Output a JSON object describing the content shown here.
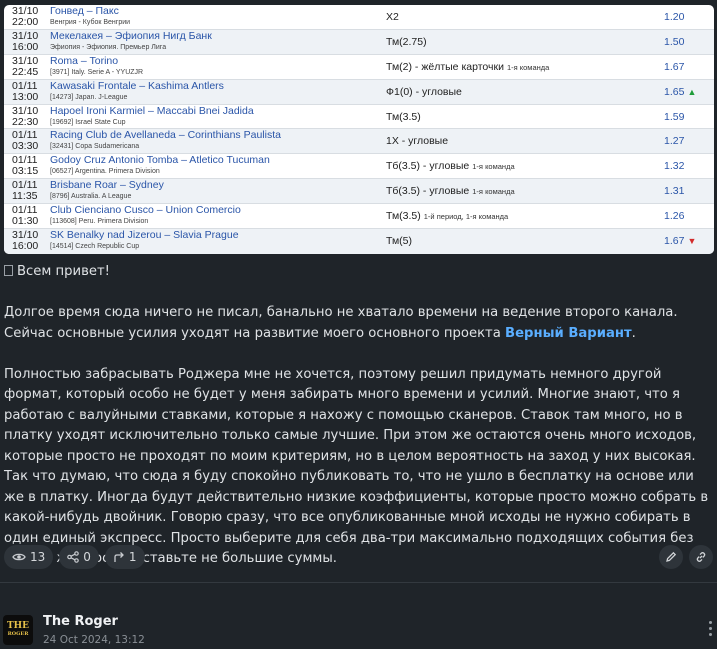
{
  "bets": [
    {
      "date": "31/10",
      "time": "22:00",
      "teams": "Гонвед – Пакс",
      "league": "Венгрия - Кубок Венгрии",
      "market": "X2",
      "market_sub": "",
      "odds": "1.20",
      "trend": ""
    },
    {
      "date": "31/10",
      "time": "16:00",
      "teams": "Мекелакея – Эфиопия Нигд Банк",
      "league": "Эфиопия - Эфиопия. Премьер Лига",
      "market": "Тм(2.75)",
      "market_sub": "",
      "odds": "1.50",
      "trend": ""
    },
    {
      "date": "31/10",
      "time": "22:45",
      "teams": "Roma – Torino",
      "league": "[3971] Italy. Serie A - YYUZJR",
      "market": "Тм(2) - жёлтые карточки",
      "market_sub": "1-я команда",
      "odds": "1.67",
      "trend": ""
    },
    {
      "date": "01/11",
      "time": "13:00",
      "teams": "Kawasaki Frontale – Kashima Antlers",
      "league": "[14273] Japan. J-League",
      "market": "Ф1(0) - угловые",
      "market_sub": "",
      "odds": "1.65",
      "trend": "up"
    },
    {
      "date": "31/10",
      "time": "22:30",
      "teams": "Hapoel Ironi Karmiel – Maccabi Bnei Jadida",
      "league": "[19692] Israel State Cup",
      "market": "Тм(3.5)",
      "market_sub": "",
      "odds": "1.59",
      "trend": ""
    },
    {
      "date": "01/11",
      "time": "03:30",
      "teams": "Racing Club de Avellaneda – Corinthians Paulista",
      "league": "[32431] Copa Sudamericana",
      "market": "1X - угловые",
      "market_sub": "",
      "odds": "1.27",
      "trend": ""
    },
    {
      "date": "01/11",
      "time": "03:15",
      "teams": "Godoy Cruz Antonio Tomba – Atletico Tucuman",
      "league": "[06527] Argentina. Primera Division",
      "market": "Тб(3.5) - угловые",
      "market_sub": "1-я команда",
      "odds": "1.32",
      "trend": ""
    },
    {
      "date": "01/11",
      "time": "11:35",
      "teams": "Brisbane Roar – Sydney",
      "league": "[8796] Australia. A League",
      "market": "Тб(3.5) - угловые",
      "market_sub": "1-я команда",
      "odds": "1.31",
      "trend": ""
    },
    {
      "date": "01/11",
      "time": "01:30",
      "teams": "Club Cienciano Cusco – Union Comercio",
      "league": "[113608] Peru. Primera Division",
      "market": "Тм(3.5)",
      "market_sub": "1-й период, 1-я команда",
      "odds": "1.26",
      "trend": ""
    },
    {
      "date": "31/10",
      "time": "16:00",
      "teams": "SK Benalky nad Jizerou – Slavia Prague",
      "league": "[14514] Czech Republic Cup",
      "market": "Тм(5)",
      "market_sub": "",
      "odds": "1.67",
      "trend": "down"
    }
  ],
  "post": {
    "greeting": "Всем привет!",
    "p1_before": "Долгое время сюда ничего не писал, банально не хватало времени на ведение второго канала. Сейчас основные усилия уходят на развитие моего основного проекта ",
    "p1_link": "Верный Вариант",
    "p1_after": ".",
    "p2": "Полностью забрасывать Роджера мне не хочется, поэтому решил придумать немного другой формат, который особо не будет у меня забирать много времени и усилий. Многие знают, что я работаю с валуйными ставками, которые я нахожу с помощью сканеров. Ставок там много, но в платку уходят исключительно только самые лучшие. При этом же остаются очень много исходов, которые просто не проходят по моим критериям, но в целом вероятность на заход у них высокая. Так что думаю, что сюда я буду спокойно публиковать то, что не ушло в бесплатку на основе или же в платку. Иногда будут действительно низкие коэффициенты, которые просто можно собрать в какой-нибудь двойник. Говорю сразу, что все опубликованные мной исходы не нужно собирать в один единый экспресс. Просто выберите для себя два-три максимально подходящих события без особой жадности и ставьте не большие суммы."
  },
  "stats": {
    "views": "13",
    "shares": "0",
    "reposts": "1"
  },
  "author": {
    "name": "The Roger",
    "time": "24 Oct 2024, 13:12",
    "avatar_text": "THE",
    "avatar_sub": "ROGER"
  },
  "colors": {
    "link": "#5aaeff",
    "odds": "#2a55a8",
    "up": "#1f9d3a",
    "down": "#d22b2b",
    "bg": "#1f2429"
  }
}
